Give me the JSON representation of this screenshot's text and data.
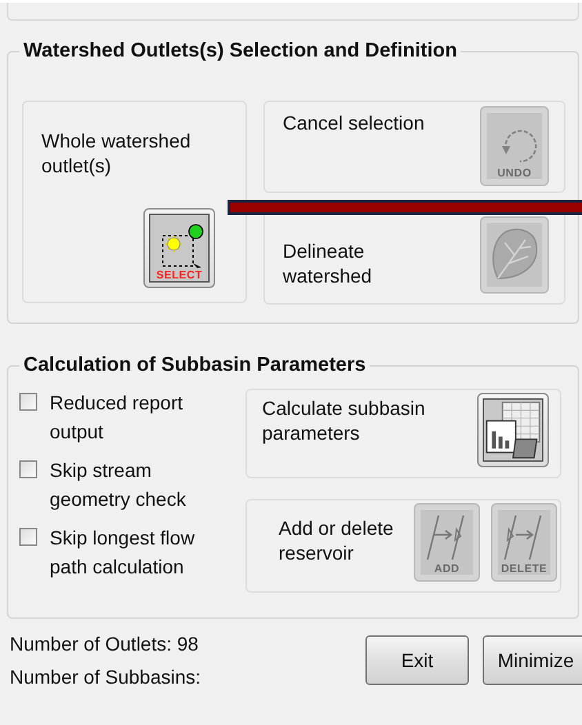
{
  "outlet_group": {
    "title": "Watershed Outlets(s) Selection and Definition",
    "whole_outlet": {
      "label": "Whole watershed outlet(s)",
      "button": {
        "caption": "SELECT",
        "disabled": false
      }
    },
    "cancel": {
      "label": "Cancel selection",
      "button": {
        "caption": "UNDO",
        "disabled": true
      }
    },
    "delineate": {
      "label": "Delineate watershed",
      "button": {
        "disabled": true
      }
    }
  },
  "subbasin_group": {
    "title": "Calculation of Subbasin Parameters",
    "options": [
      {
        "label": "Reduced report output",
        "checked": false
      },
      {
        "label": "Skip stream geometry check",
        "checked": false
      },
      {
        "label": "Skip longest flow path calculation",
        "checked": false
      }
    ],
    "calculate": {
      "label": "Calculate subbasin parameters",
      "button": {
        "disabled": false
      }
    },
    "reservoir": {
      "label": "Add or delete reservoir",
      "buttons": [
        {
          "caption": "ADD",
          "disabled": true
        },
        {
          "caption": "DELETE",
          "disabled": true
        }
      ]
    }
  },
  "status": [
    "Number of Outlets: 98",
    "Number of Subbasins:"
  ],
  "buttons": [
    "Exit",
    "Minimize"
  ]
}
